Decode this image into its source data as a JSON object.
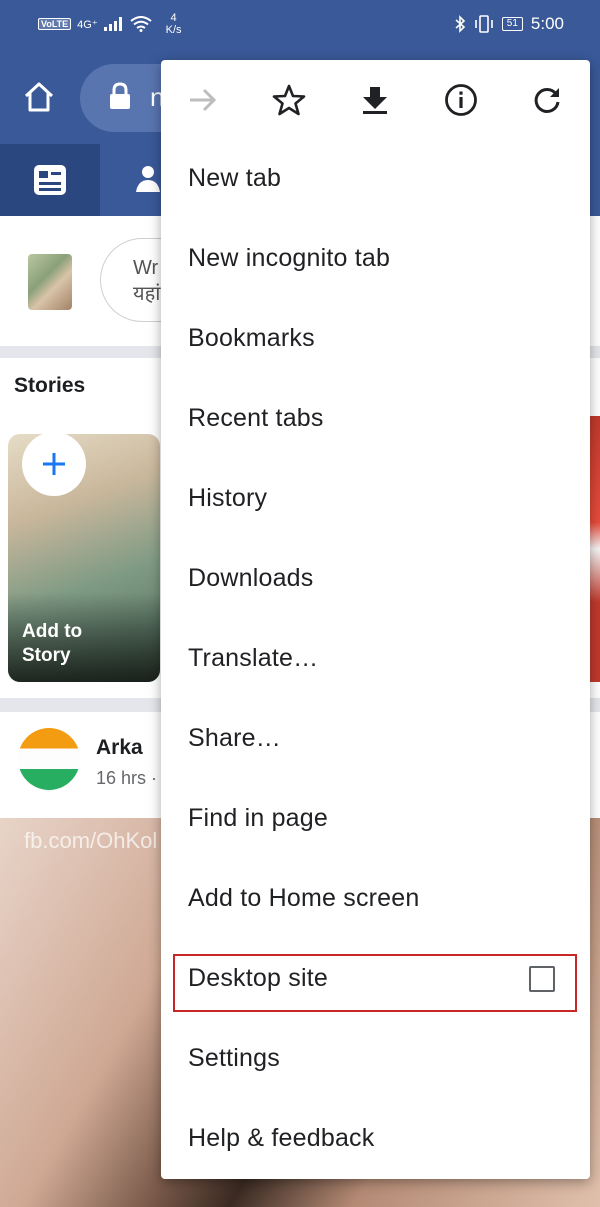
{
  "status": {
    "network_badge": "VoLTE",
    "network_type": "4G⁺",
    "speed_value": "4",
    "speed_unit": "K/s",
    "battery": "51",
    "time": "5:00"
  },
  "toolbar": {
    "url_partial": "n"
  },
  "composer": {
    "placeholder_line1": "Wr",
    "placeholder_line2": "यहां"
  },
  "stories": {
    "title": "Stories",
    "add_label_line1": "Add to",
    "add_label_line2": "Story"
  },
  "post": {
    "author": "Arka",
    "time": "16 hrs ·",
    "watermark": "fb.com/OhKol"
  },
  "menu": {
    "icons": [
      "forward-icon",
      "star-icon",
      "download-icon",
      "info-icon",
      "refresh-icon"
    ],
    "items": [
      {
        "label": "New tab"
      },
      {
        "label": "New incognito tab"
      },
      {
        "label": "Bookmarks"
      },
      {
        "label": "Recent tabs"
      },
      {
        "label": "History"
      },
      {
        "label": "Downloads"
      },
      {
        "label": "Translate…"
      },
      {
        "label": "Share…"
      },
      {
        "label": "Find in page"
      },
      {
        "label": "Add to Home screen"
      },
      {
        "label": "Desktop site",
        "checked": false
      },
      {
        "label": "Settings"
      },
      {
        "label": "Help & feedback"
      }
    ]
  },
  "colors": {
    "facebook_blue": "#3a5998",
    "highlight_red": "#c62828",
    "menu_text": "#202124"
  }
}
